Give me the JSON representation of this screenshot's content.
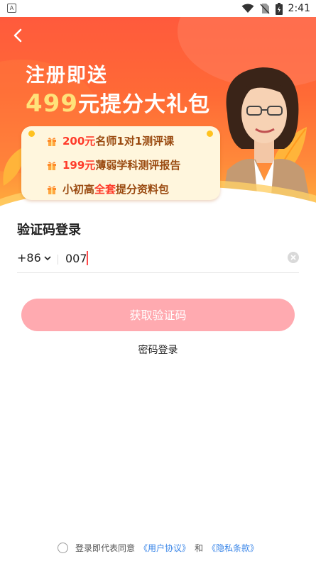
{
  "status_bar": {
    "time": "2:41",
    "app_badge": "A"
  },
  "banner": {
    "headline_line1": "注册即送",
    "headline_amount": "499",
    "headline_rest": "元提分大礼包",
    "perks": [
      {
        "highlight": "200元",
        "text": "名师1对1测评课"
      },
      {
        "highlight": "199元",
        "text": "薄弱学科测评报告"
      },
      {
        "highlight": "",
        "prefix": "小初高",
        "highlight2": "全套",
        "text": "提分资料包"
      }
    ]
  },
  "login": {
    "title": "验证码登录",
    "country_code": "+86",
    "phone_value": "007",
    "get_code_label": "获取验证码",
    "password_login_label": "密码登录"
  },
  "agreement": {
    "text": "登录即代表同意",
    "user_agreement": "《用户协议》",
    "and": "和",
    "privacy": "《隐私条款》"
  },
  "colors": {
    "banner_top": "#ff5a3c",
    "banner_bottom": "#ffb13d",
    "button_bg": "#ffaab0",
    "link": "#3a86e8",
    "caret": "#ff4b4b"
  }
}
